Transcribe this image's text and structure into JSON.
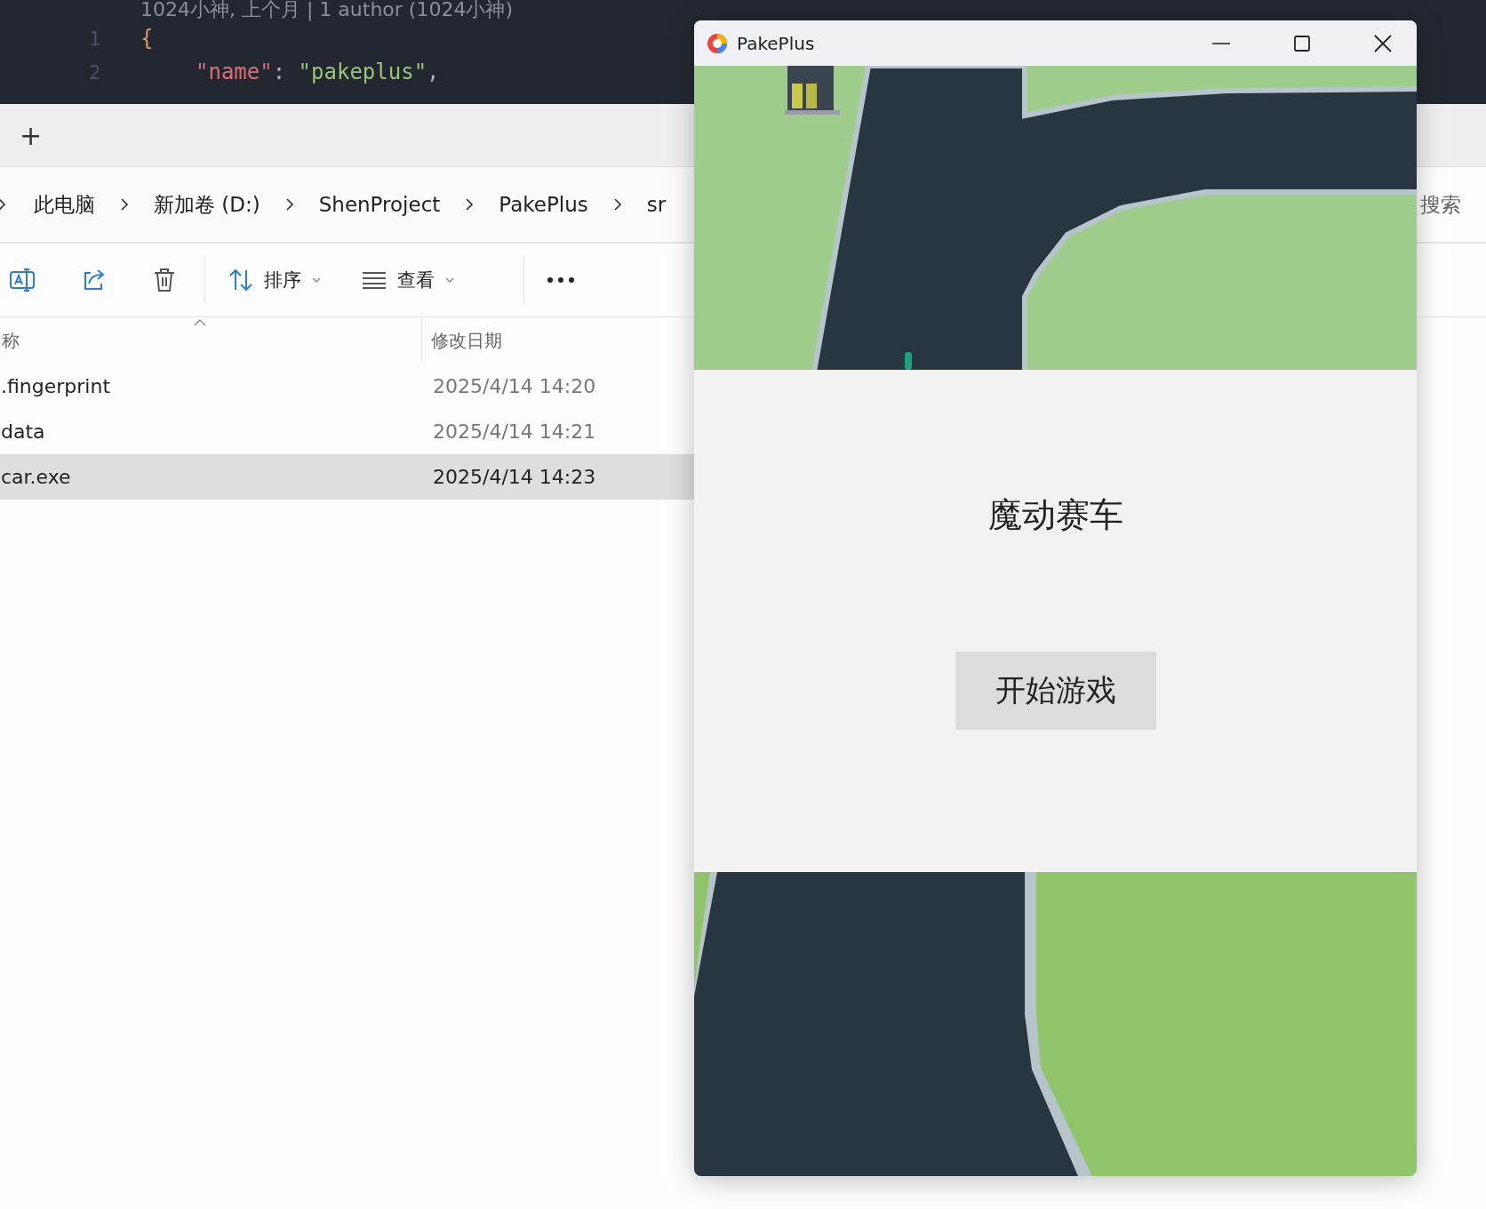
{
  "editor": {
    "blame": "1024小神, 上个月 | 1 author (1024小神)",
    "lines": [
      {
        "number": "1",
        "tokens": [
          {
            "kind": "brace",
            "text": "{"
          }
        ]
      },
      {
        "number": "2",
        "tokens": [
          {
            "kind": "key",
            "text": "\"name\""
          },
          {
            "kind": "punct",
            "text": ": "
          },
          {
            "kind": "string",
            "text": "\"pakeplus\""
          },
          {
            "kind": "punct",
            "text": ","
          }
        ]
      }
    ]
  },
  "explorer": {
    "new_tab": "+",
    "breadcrumb": [
      "此电脑",
      "新加卷 (D:)",
      "ShenProject",
      "PakePlus",
      "sr"
    ],
    "search": {
      "placeholder": "搜索"
    },
    "toolbar": [
      {
        "kind": "rename"
      },
      {
        "kind": "share"
      },
      {
        "kind": "delete"
      },
      {
        "kind": "sort",
        "label": "排序"
      },
      {
        "kind": "view",
        "label": "查看"
      },
      {
        "kind": "more"
      }
    ],
    "columns": [
      "称",
      "修改日期"
    ],
    "rows": [
      {
        "name": ".fingerprint",
        "modified": "2025/4/14 14:20",
        "selected": false
      },
      {
        "name": "data",
        "modified": "2025/4/14 14:21",
        "selected": false
      },
      {
        "name": "car.exe",
        "modified": "2025/4/14 14:23",
        "selected": true
      }
    ]
  },
  "app_window": {
    "title": "PakePlus",
    "game_title": "魔动赛车",
    "start_button": "开始游戏"
  }
}
